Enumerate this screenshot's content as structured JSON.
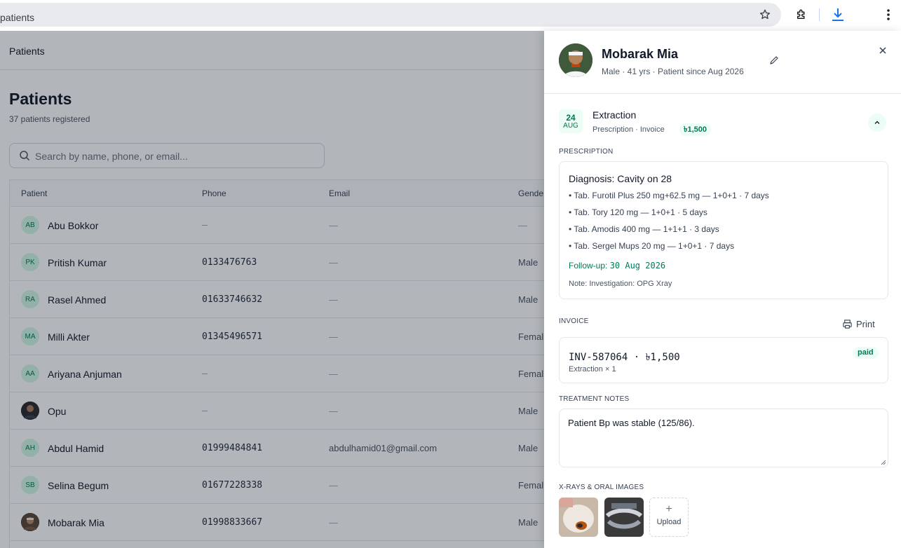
{
  "browser": {
    "url": "patients",
    "icons": [
      "star-icon",
      "extension-icon",
      "download-icon",
      "more-vert-icon"
    ]
  },
  "topbar": {
    "title": "Patients"
  },
  "page": {
    "title": "Patients",
    "subtitle": "37 patients registered",
    "search_placeholder": "Search by name, phone, or email..."
  },
  "table": {
    "headers": {
      "patient": "Patient",
      "phone": "Phone",
      "email": "Email",
      "gender": "Gende"
    },
    "rows": [
      {
        "initials": "AB",
        "name": "Abu Bokkor",
        "phone": "–",
        "email": "—",
        "gender": "—"
      },
      {
        "initials": "PK",
        "name": "Pritish Kumar",
        "phone": "0133476763",
        "email": "—",
        "gender": "Male"
      },
      {
        "initials": "RA",
        "name": "Rasel Ahmed",
        "phone": "01633746632",
        "email": "—",
        "gender": "Male"
      },
      {
        "initials": "MA",
        "name": "Milli Akter",
        "phone": "01345496571",
        "email": "—",
        "gender": "Femal"
      },
      {
        "initials": "AA",
        "name": "Ariyana Anjuman",
        "phone": "–",
        "email": "—",
        "gender": "Femal"
      },
      {
        "initials": "",
        "name": "Opu",
        "phone": "–",
        "email": "—",
        "gender": "Male"
      },
      {
        "initials": "AH",
        "name": "Abdul Hamid",
        "phone": "01999484841",
        "email": "abdulhamid01@gmail.com",
        "gender": "Male"
      },
      {
        "initials": "SB",
        "name": "Selina Begum",
        "phone": "01677228338",
        "email": "—",
        "gender": "Femal"
      },
      {
        "initials": "",
        "name": "Mobarak Mia",
        "phone": "01998833667",
        "email": "—",
        "gender": "Male"
      }
    ]
  },
  "drawer": {
    "name": "Mobarak Mia",
    "meta": "Male · 41 yrs · Patient since Aug 2026",
    "visit": {
      "day": "24",
      "month": "AUG",
      "title": "Extraction",
      "subtitle": "Prescription · Invoice",
      "amount": "৳1,500"
    },
    "prescription": {
      "label": "PRESCRIPTION",
      "diagnosis": "Diagnosis: Cavity on 28",
      "items": [
        "• Tab. Furotil Plus 250 mg+62.5 mg — 1+0+1 · 7 days",
        "• Tab. Tory 120 mg — 1+0+1 · 5 days",
        "• Tab. Amodis 400 mg — 1+1+1 · 3 days",
        "• Tab. Sergel Mups 20 mg — 1+0+1 · 7 days"
      ],
      "followup_label": "Follow-up: ",
      "followup_date": "30 Aug 2026",
      "note": "Note: Investigation: OPG Xray"
    },
    "invoice": {
      "label": "INVOICE",
      "print_label": "Print",
      "id_amount": "INV-587064 · ৳1,500",
      "line": "Extraction × 1",
      "status": "paid"
    },
    "notes": {
      "label": "TREATMENT NOTES",
      "value": "Patient Bp was stable (125/86)."
    },
    "images": {
      "label": "X-RAYS & ORAL IMAGES",
      "upload_label": "Upload"
    }
  },
  "colors": {
    "accent": "#047857",
    "accent_bg": "#ecfdf5",
    "overlay": "#111827"
  }
}
